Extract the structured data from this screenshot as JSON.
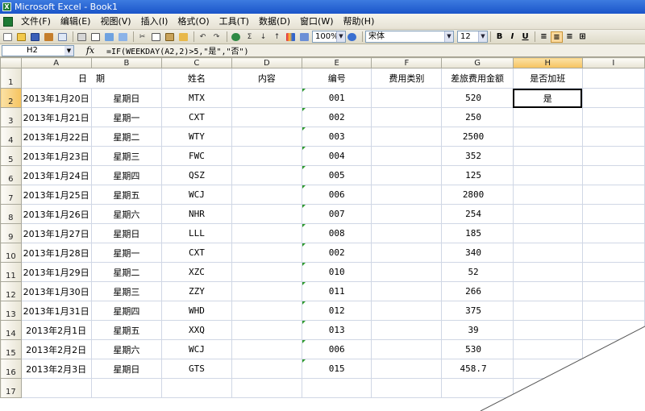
{
  "window": {
    "title": "Microsoft Excel - Book1"
  },
  "menu": [
    "文件(F)",
    "编辑(E)",
    "视图(V)",
    "插入(I)",
    "格式(O)",
    "工具(T)",
    "数据(D)",
    "窗口(W)",
    "帮助(H)"
  ],
  "toolbar": {
    "zoom": "100%",
    "font_name": "宋体",
    "font_size": "12",
    "bold_label": "B",
    "italic_label": "I",
    "underline_label": "U"
  },
  "formula_bar": {
    "cell_ref": "H2",
    "fx_label": "fx",
    "formula": "=IF(WEEKDAY(A2,2)>5,\"是\",\"否\")"
  },
  "columns": [
    "A",
    "B",
    "C",
    "D",
    "E",
    "F",
    "G",
    "H",
    "I"
  ],
  "header_row": {
    "row_label": "1",
    "date": "日　期",
    "name": "姓名",
    "content": "内容",
    "number": "编号",
    "fee_type": "费用类别",
    "amount": "差旅费用金额",
    "overtime": "是否加班"
  },
  "rows": [
    {
      "row": "2",
      "date": "2013年1月20日",
      "weekday": "星期日",
      "name": "MTX",
      "code": "001",
      "amount": "520",
      "overtime": "是"
    },
    {
      "row": "3",
      "date": "2013年1月21日",
      "weekday": "星期一",
      "name": "CXT",
      "code": "002",
      "amount": "250",
      "overtime": ""
    },
    {
      "row": "4",
      "date": "2013年1月22日",
      "weekday": "星期二",
      "name": "WTY",
      "code": "003",
      "amount": "2500",
      "overtime": ""
    },
    {
      "row": "5",
      "date": "2013年1月23日",
      "weekday": "星期三",
      "name": "FWC",
      "code": "004",
      "amount": "352",
      "overtime": ""
    },
    {
      "row": "6",
      "date": "2013年1月24日",
      "weekday": "星期四",
      "name": "QSZ",
      "code": "005",
      "amount": "125",
      "overtime": ""
    },
    {
      "row": "7",
      "date": "2013年1月25日",
      "weekday": "星期五",
      "name": "WCJ",
      "code": "006",
      "amount": "2800",
      "overtime": ""
    },
    {
      "row": "8",
      "date": "2013年1月26日",
      "weekday": "星期六",
      "name": "NHR",
      "code": "007",
      "amount": "254",
      "overtime": ""
    },
    {
      "row": "9",
      "date": "2013年1月27日",
      "weekday": "星期日",
      "name": "LLL",
      "code": "008",
      "amount": "185",
      "overtime": ""
    },
    {
      "row": "10",
      "date": "2013年1月28日",
      "weekday": "星期一",
      "name": "CXT",
      "code": "002",
      "amount": "340",
      "overtime": ""
    },
    {
      "row": "11",
      "date": "2013年1月29日",
      "weekday": "星期二",
      "name": "XZC",
      "code": "010",
      "amount": "52",
      "overtime": ""
    },
    {
      "row": "12",
      "date": "2013年1月30日",
      "weekday": "星期三",
      "name": "ZZY",
      "code": "011",
      "amount": "266",
      "overtime": ""
    },
    {
      "row": "13",
      "date": "2013年1月31日",
      "weekday": "星期四",
      "name": "WHD",
      "code": "012",
      "amount": "375",
      "overtime": ""
    },
    {
      "row": "14",
      "date": "2013年2月1日",
      "weekday": "星期五",
      "name": "XXQ",
      "code": "013",
      "amount": "39",
      "overtime": ""
    },
    {
      "row": "15",
      "date": "2013年2月2日",
      "weekday": "星期六",
      "name": "WCJ",
      "code": "006",
      "amount": "530",
      "overtime": ""
    },
    {
      "row": "16",
      "date": "2013年2月3日",
      "weekday": "星期日",
      "name": "GTS",
      "code": "015",
      "amount": "458.7",
      "overtime": ""
    },
    {
      "row": "17",
      "date": "",
      "weekday": "",
      "name": "",
      "code": "",
      "amount": "",
      "overtime": ""
    }
  ],
  "colors": {
    "title_bar": "#1b55c9",
    "selected_header": "#f6c35e",
    "grid_line": "#d0d7e5"
  }
}
